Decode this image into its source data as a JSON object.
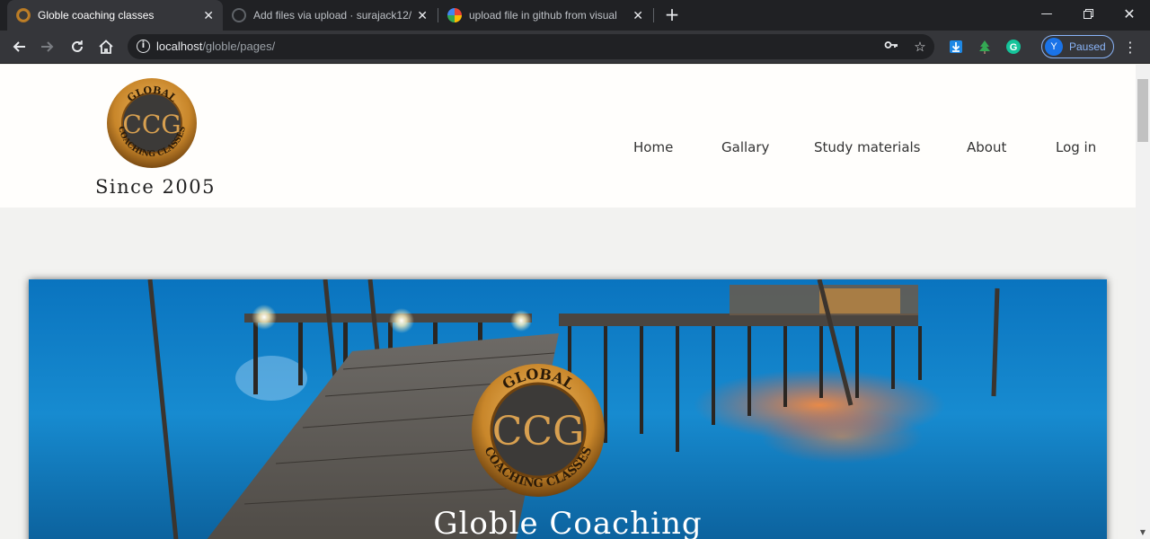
{
  "browser": {
    "tabs": [
      {
        "title": "Globle coaching classes",
        "active": true
      },
      {
        "title": "Add files via upload · surajack12/",
        "active": false
      },
      {
        "title": "upload file in github from visual",
        "active": false
      }
    ],
    "url_host": "localhost",
    "url_path": "/globle/pages/",
    "profile_initial": "Y",
    "profile_status": "Paused"
  },
  "site": {
    "logo": {
      "top_text": "GLOBAL",
      "bottom_text": "COACHING CLASSES",
      "monogram": "CCG"
    },
    "since": "Since 2005",
    "nav": [
      "Home",
      "Gallary",
      "Study materials",
      "About",
      "Log in"
    ],
    "hero_title": "Globle Coaching"
  },
  "colors": {
    "chrome_dark": "#202124",
    "chrome_mid": "#35363a",
    "accent_gold": "#c8862a",
    "sea_blue": "#1688cc"
  }
}
